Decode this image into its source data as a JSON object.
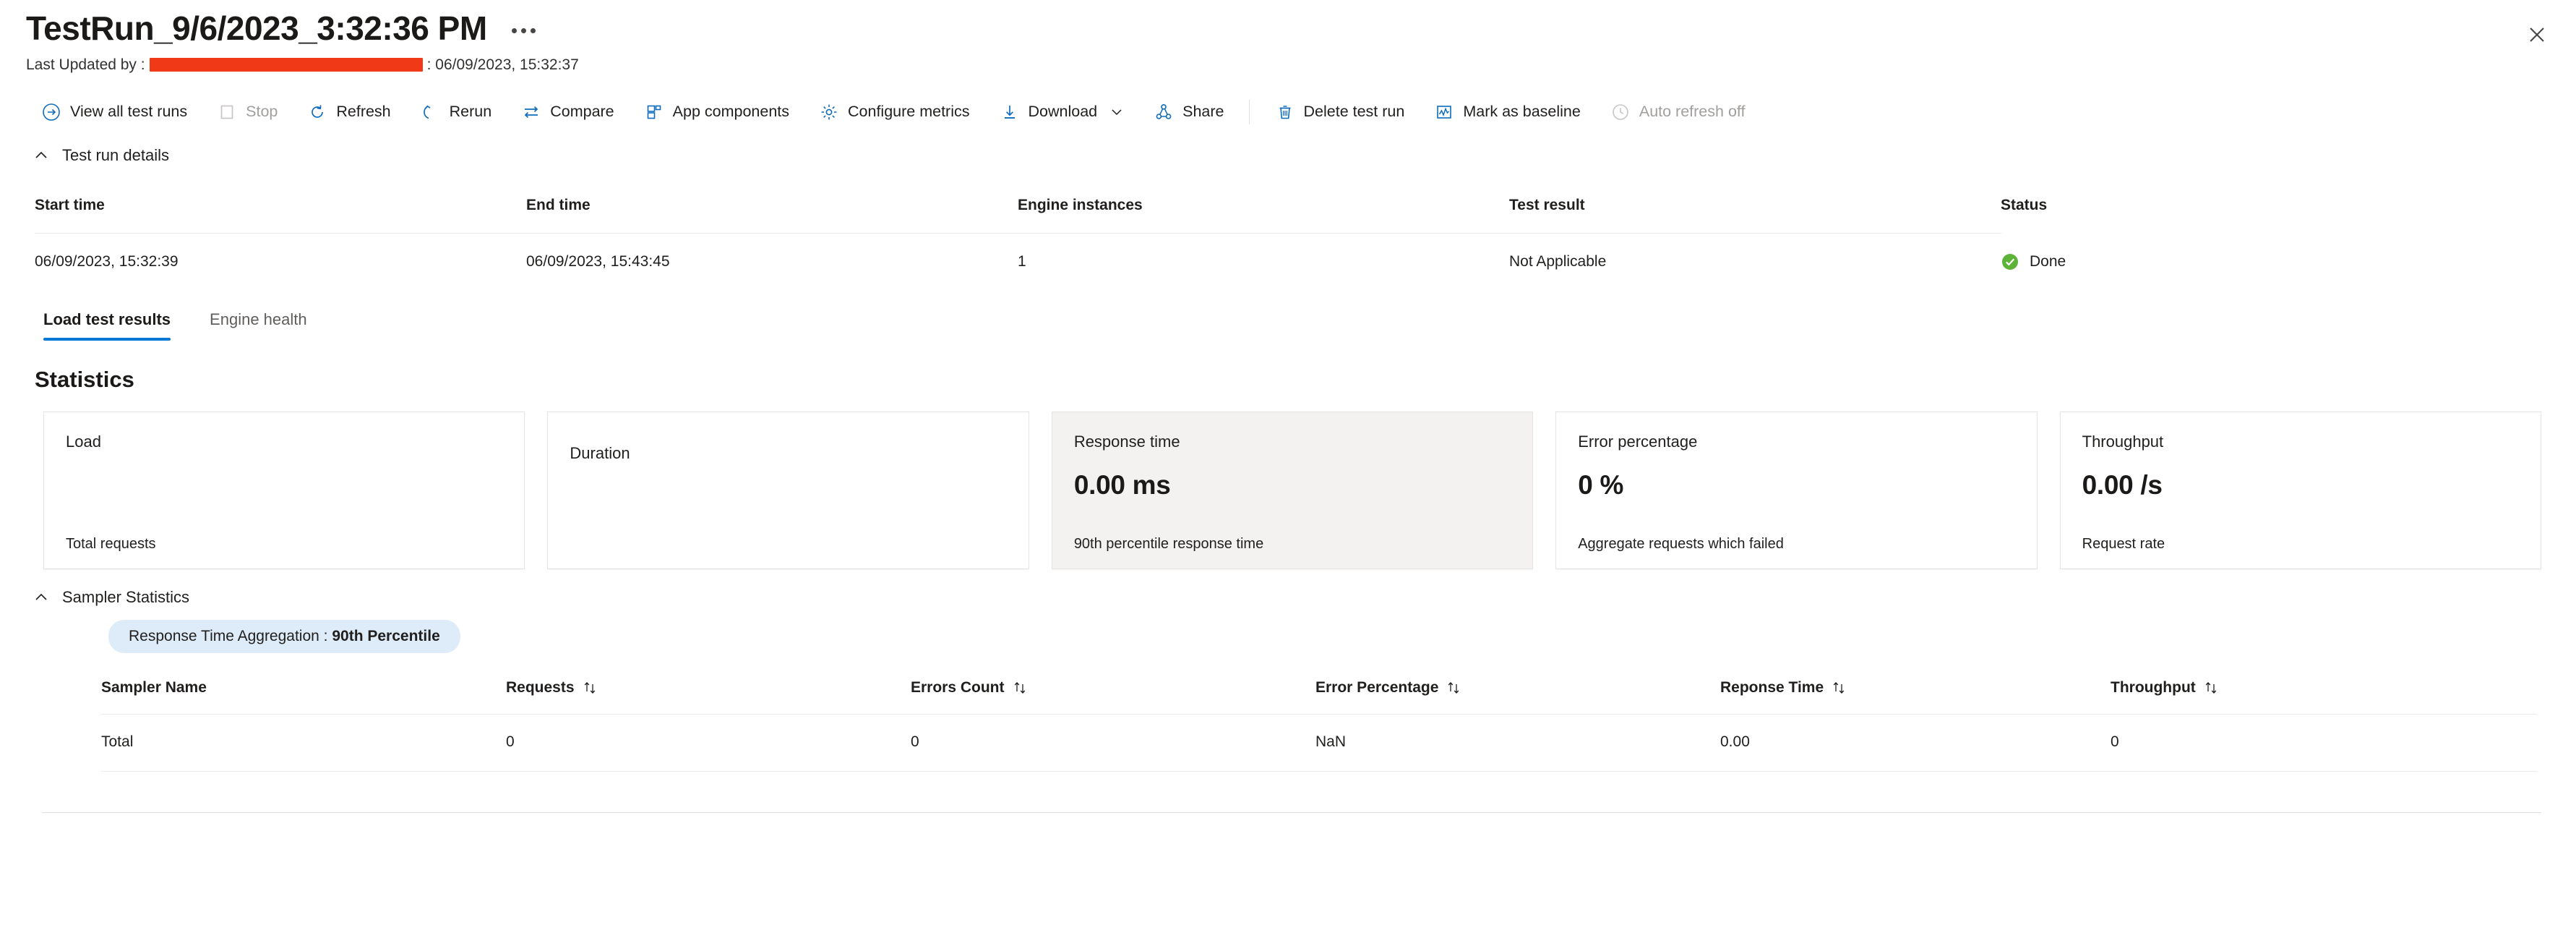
{
  "header": {
    "title": "TestRun_9/6/2023_3:32:36 PM",
    "more_menu_name": "more-options",
    "last_updated_prefix": "Last Updated by :",
    "last_updated_suffix": ": 06/09/2023, 15:32:37",
    "close_label": "Close"
  },
  "toolbar": {
    "view_all_test_runs": "View all test runs",
    "stop": "Stop",
    "refresh": "Refresh",
    "rerun": "Rerun",
    "compare": "Compare",
    "app_components": "App components",
    "configure_metrics": "Configure metrics",
    "download": "Download",
    "share": "Share",
    "delete_test_run": "Delete test run",
    "mark_as_baseline": "Mark as baseline",
    "auto_refresh": "Auto refresh off"
  },
  "test_run_details": {
    "section_title": "Test run details",
    "columns": [
      "Start time",
      "End time",
      "Engine instances",
      "Test result",
      "Status"
    ],
    "values": {
      "start_time": "06/09/2023, 15:32:39",
      "end_time": "06/09/2023, 15:43:45",
      "engine_instances": "1",
      "test_result": "Not Applicable",
      "status": "Done"
    },
    "status_color": "#5cb338"
  },
  "tabs": [
    {
      "label": "Load test results",
      "active": true
    },
    {
      "label": "Engine health",
      "active": false
    }
  ],
  "statistics": {
    "heading": "Statistics",
    "cards": [
      {
        "label": "Load",
        "value": "",
        "foot": "Total requests",
        "selected": false
      },
      {
        "label": "Duration",
        "value": "",
        "foot": "",
        "selected": false
      },
      {
        "label": "Response time",
        "value": "0.00 ms",
        "foot": "90th percentile response time",
        "selected": true
      },
      {
        "label": "Error percentage",
        "value": "0 %",
        "foot": "Aggregate requests which failed",
        "selected": false
      },
      {
        "label": "Throughput",
        "value": "0.00 /s",
        "foot": "Request rate",
        "selected": false
      }
    ]
  },
  "sampler_statistics": {
    "section_title": "Sampler Statistics",
    "aggregation_pill_prefix": "Response Time Aggregation : ",
    "aggregation_pill_value": "90th Percentile",
    "columns": [
      {
        "label": "Sampler Name",
        "sortable": false
      },
      {
        "label": "Requests",
        "sortable": true
      },
      {
        "label": "Errors Count",
        "sortable": true
      },
      {
        "label": "Error Percentage",
        "sortable": true
      },
      {
        "label": "Reponse Time",
        "sortable": true
      },
      {
        "label": "Throughput",
        "sortable": true
      }
    ],
    "rows": [
      [
        "Total",
        "0",
        "0",
        "NaN",
        "0.00",
        "0"
      ]
    ]
  },
  "colors": {
    "accent": "#0078d4",
    "success": "#5cb338",
    "pill_bg": "#deecf9",
    "redaction": "#f03a17"
  }
}
